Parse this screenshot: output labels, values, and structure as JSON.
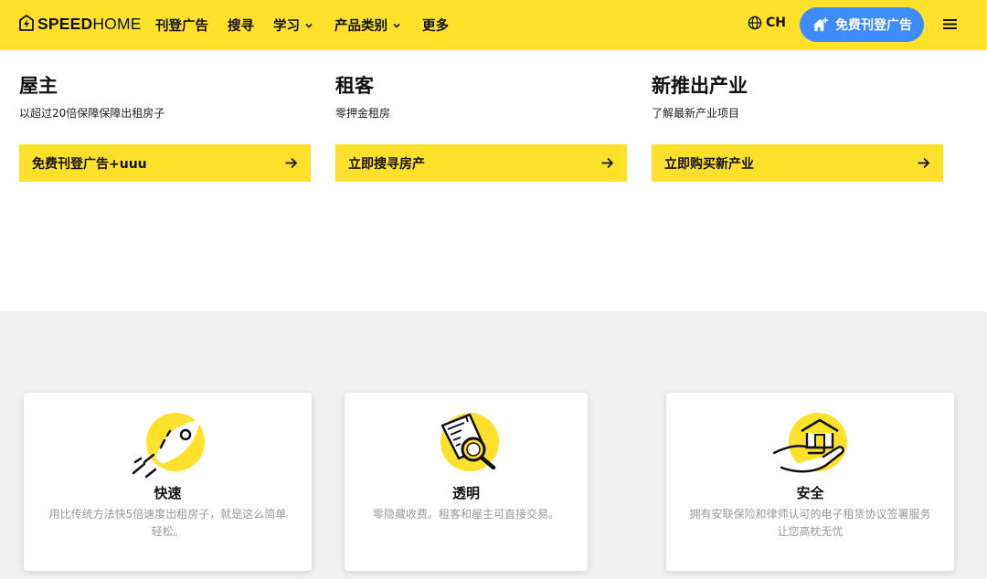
{
  "header": {
    "brand_bold": "SPEED",
    "brand_light": "HOME",
    "nav": [
      {
        "label": "刊登广告"
      },
      {
        "label": "搜寻"
      },
      {
        "label": "学习"
      },
      {
        "label": "产品类别"
      },
      {
        "label": "更多"
      }
    ],
    "lang_label": "CH",
    "post_button_label": "免费刊登广告",
    "accent_color": "#FFE12B",
    "button_color": "#3D8BFF"
  },
  "columns": [
    {
      "title": "屋主",
      "subtitle": "以超过20倍保障保障出租房子",
      "cta": "免费刊登广告+uuu"
    },
    {
      "title": "租客",
      "subtitle": "零押金租房",
      "cta": "立即搜寻房产"
    },
    {
      "title": "新推出产业",
      "subtitle": "了解最新产业项目",
      "cta": "立即购买新产业"
    }
  ],
  "features": [
    {
      "icon": "rocket-icon",
      "title": "快速",
      "desc": "用比传统方法快5倍速度出租房子，就是这么简单轻松。"
    },
    {
      "icon": "document-search-icon",
      "title": "透明",
      "desc": "零隐藏收费。租客和屋主可直接交易。"
    },
    {
      "icon": "hand-house-icon",
      "title": "安全",
      "desc": "拥有安联保险和律师认可的电子租赁协议签署服务让您高枕无忧"
    }
  ]
}
